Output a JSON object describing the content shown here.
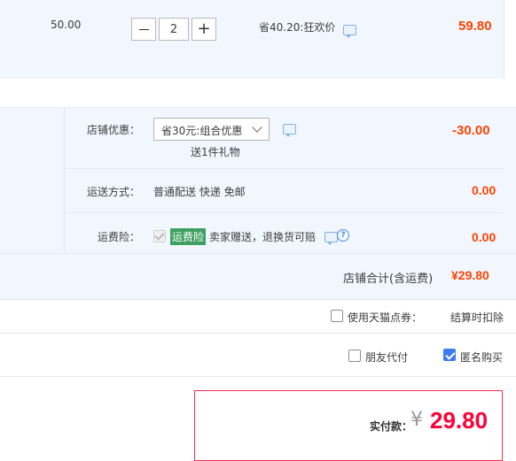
{
  "item": {
    "unit_price": "50.00",
    "quantity": "2",
    "minus_label": "—",
    "plus_label": "+",
    "promo_text": "省40.20:狂欢价",
    "subtotal": "59.80"
  },
  "shop": {
    "discount_label": "店铺优惠：",
    "discount_selected": "省30元:组合优惠",
    "gift_text": "送1件礼物",
    "discount_amount": "-30.00",
    "shipping_label": "运送方式：",
    "shipping_value": "普通配送 快递 免邮",
    "shipping_amount": "0.00",
    "insurance_label": "运费险：",
    "insurance_badge": "运费险",
    "insurance_text": "卖家赠送，退换货可赔",
    "insurance_amount": "0.00",
    "total_label": "店铺合计(含运费)",
    "total_amount": "¥29.80"
  },
  "options": {
    "tmall_points_label": "使用天猫点券：",
    "tmall_points_value": "结算时扣除",
    "friend_pay_label": "朋友代付",
    "anonymous_label": "匿名购买"
  },
  "summary": {
    "actual_pay_label": "实付款：",
    "currency": "¥",
    "actual_pay_amount": "29.80"
  }
}
